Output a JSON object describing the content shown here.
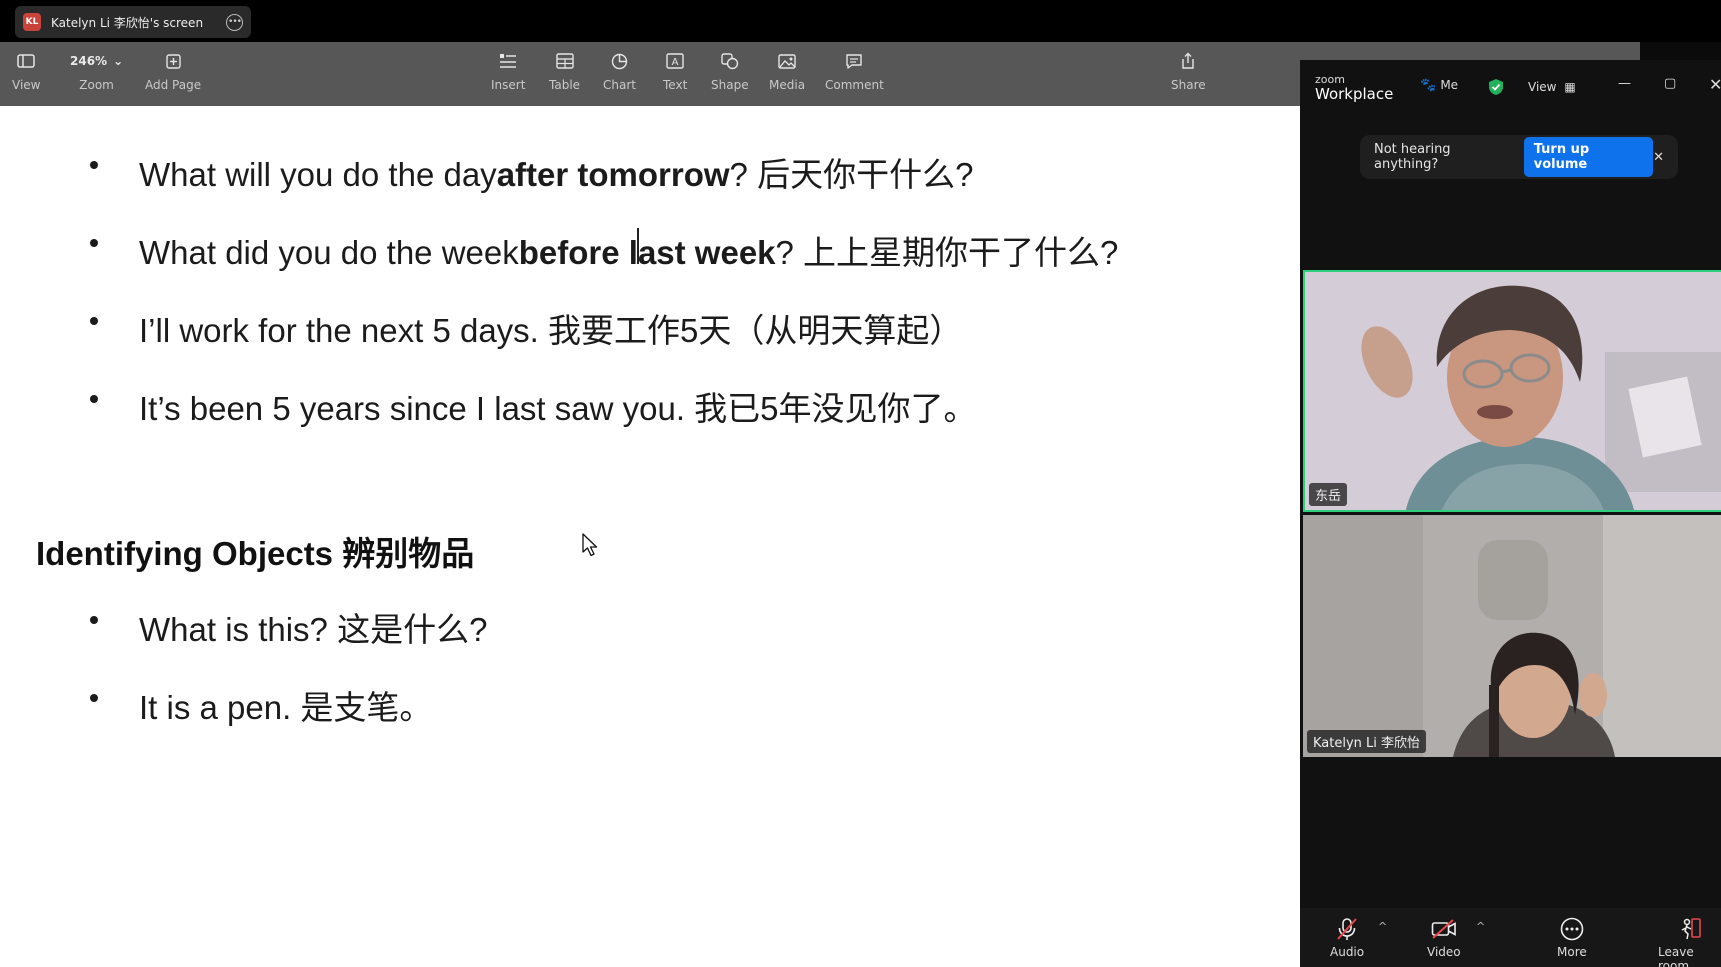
{
  "share_bar": {
    "initials": "KL",
    "title": "Katelyn Li 李欣怡's screen"
  },
  "toolbar": {
    "view": "View",
    "zoom_value": "246%",
    "zoom": "Zoom",
    "add_page": "Add Page",
    "insert": "Insert",
    "table": "Table",
    "chart": "Chart",
    "text": "Text",
    "shape": "Shape",
    "media": "Media",
    "comment": "Comment",
    "share": "Share"
  },
  "document": {
    "bullets_top": [
      {
        "pre": "What will you do the day ",
        "bold": "after tomorrow",
        "post": "? 后天你干什么?"
      },
      {
        "pre": "What did you do the week ",
        "bold_a": "before l",
        "bold_b": "ast week",
        "post": "? 上上星期你干了什么?"
      },
      {
        "pre": "I’ll work for the next 5 days. 我要工作5天（从明天算起）"
      },
      {
        "pre": "It’s been 5 years since I last saw you. 我已5年没见你了。"
      }
    ],
    "heading": "Identifying Objects 辨别物品",
    "bullets_bottom": [
      {
        "pre": "What is this? 这是什么?"
      },
      {
        "pre": "It is a pen. 是支笔。"
      }
    ]
  },
  "zoom": {
    "logo_small": "zoom",
    "logo_big": "Workplace",
    "meeting_short": "Me",
    "view": "View",
    "toast_text": "Not hearing anything?",
    "toast_button": "Turn up volume",
    "participant1": "东岳",
    "participant2": "Katelyn Li 李欣怡",
    "audio": "Audio",
    "video": "Video",
    "more": "More",
    "leave": "Leave room"
  }
}
